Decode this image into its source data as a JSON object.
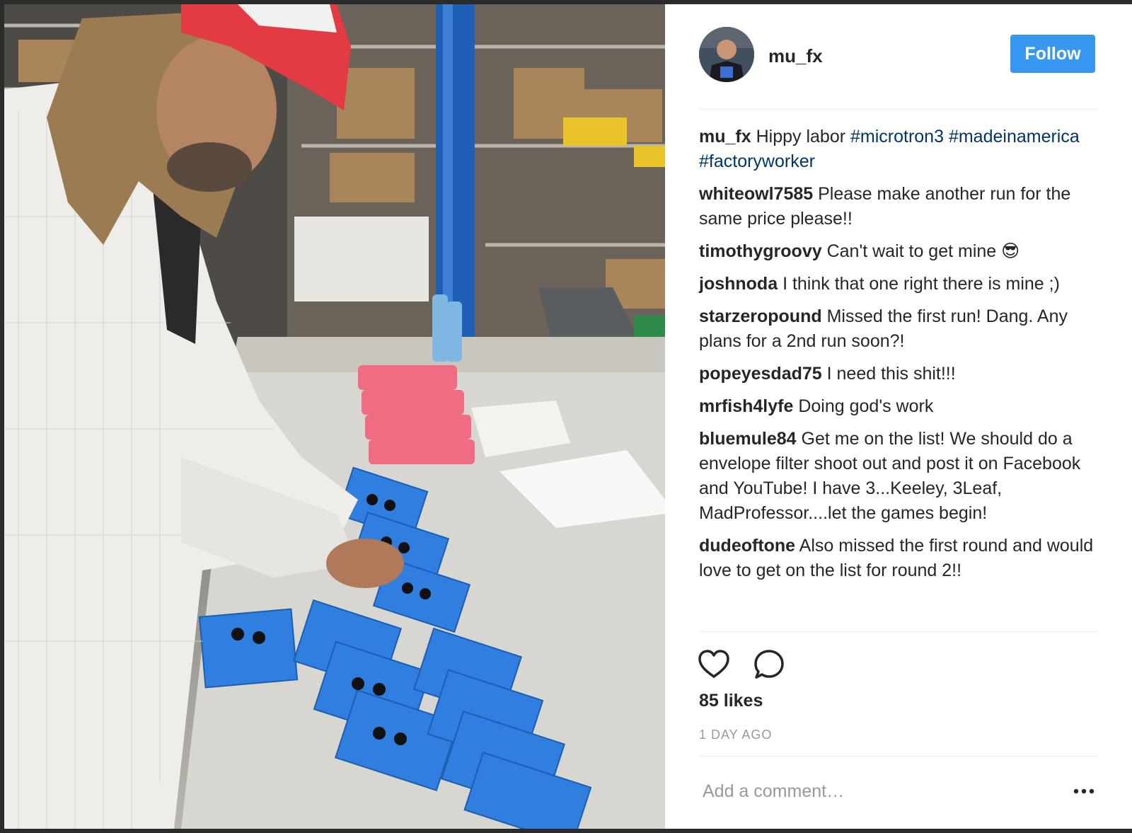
{
  "post": {
    "author": "mu_fx",
    "follow_label": "Follow",
    "caption": {
      "user": "mu_fx",
      "text": "Hippy labor",
      "hashtags": [
        "#microtron3",
        "#madeinamerica",
        "#factoryworker"
      ]
    },
    "comments": [
      {
        "user": "whiteowl7585",
        "text": "Please make another run for the same price please!!"
      },
      {
        "user": "timothygroovy",
        "text": "Can't wait to get mine 😎"
      },
      {
        "user": "joshnoda",
        "text": "I think that one right there is mine ;)"
      },
      {
        "user": "starzeropound",
        "text": "Missed the first run! Dang. Any plans for a 2nd run soon?!"
      },
      {
        "user": "popeyesdad75",
        "text": "I need this shit!!!"
      },
      {
        "user": "mrfish4lyfe",
        "text": "Doing god's work"
      },
      {
        "user": "bluemule84",
        "text": "Get me on the list! We should do a envelope filter shoot out and post it on Facebook and YouTube! I have 3...Keeley, 3Leaf, MadProfessor....let the games begin!"
      },
      {
        "user": "dudeoftone",
        "text": "Also missed the first round and would love to get on the list for round 2!!"
      }
    ],
    "likes": "85 likes",
    "timestamp": "1 DAY AGO",
    "comment_placeholder": "Add a comment…"
  },
  "icons": {
    "like": "heart-icon",
    "comment": "speech-bubble-icon",
    "more": "ellipsis-icon"
  },
  "colors": {
    "follow_button": "#3897f0",
    "hashtag": "#003569",
    "muted_text": "#999999",
    "primary_text": "#262626"
  }
}
